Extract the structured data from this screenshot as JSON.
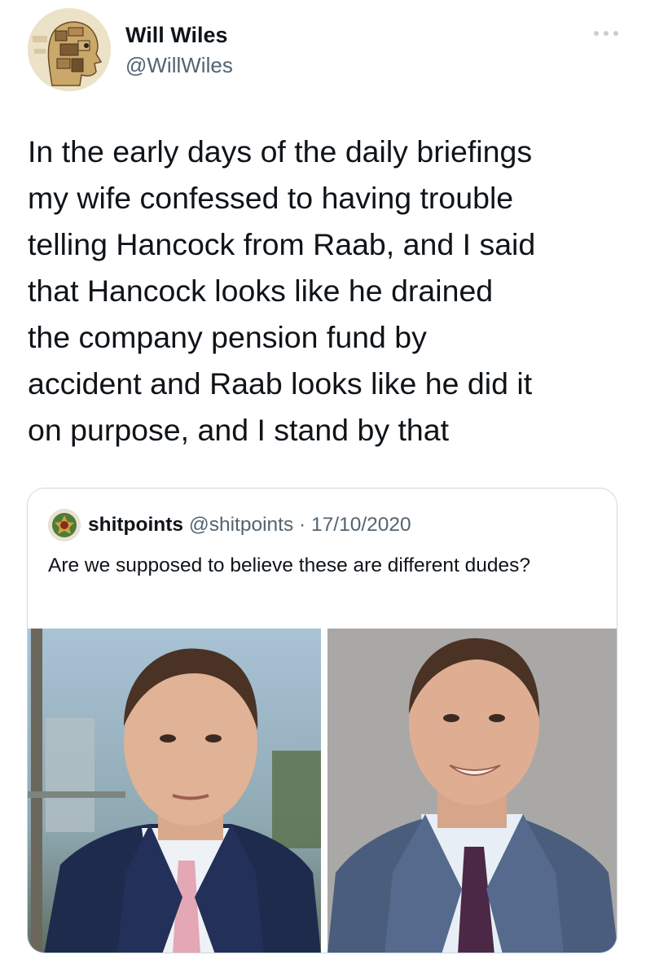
{
  "tweet": {
    "author_name": "Will Wiles",
    "author_handle": "@WillWiles",
    "more_icon": "more-horizontal-icon",
    "avatar_icon": "anatomical-head-illustration",
    "text": "In the early days of the daily briefings\nmy wife confessed to having trouble\ntelling Hancock from Raab, and I said\nthat Hancock looks like he drained\nthe company pension fund by\naccident and Raab looks like he did it\non purpose, and I stand by that"
  },
  "quote": {
    "author_name": "shitpoints",
    "author_handle": "@shitpoints",
    "separator": " · ",
    "date": "17/10/2020",
    "text": "Are we supposed to believe these are different dudes?",
    "avatar_icon": "emblem-avatar",
    "images": [
      {
        "name": "photo-hancock",
        "background": "#9bb4c7"
      },
      {
        "name": "photo-raab",
        "background": "#a9a8a6"
      }
    ]
  },
  "colors": {
    "text_primary": "#0f1419",
    "text_secondary": "#536471",
    "border": "#cfd9de",
    "suit_navy": "#1f2b4d",
    "suit_grey_blue": "#4a5d7c"
  }
}
